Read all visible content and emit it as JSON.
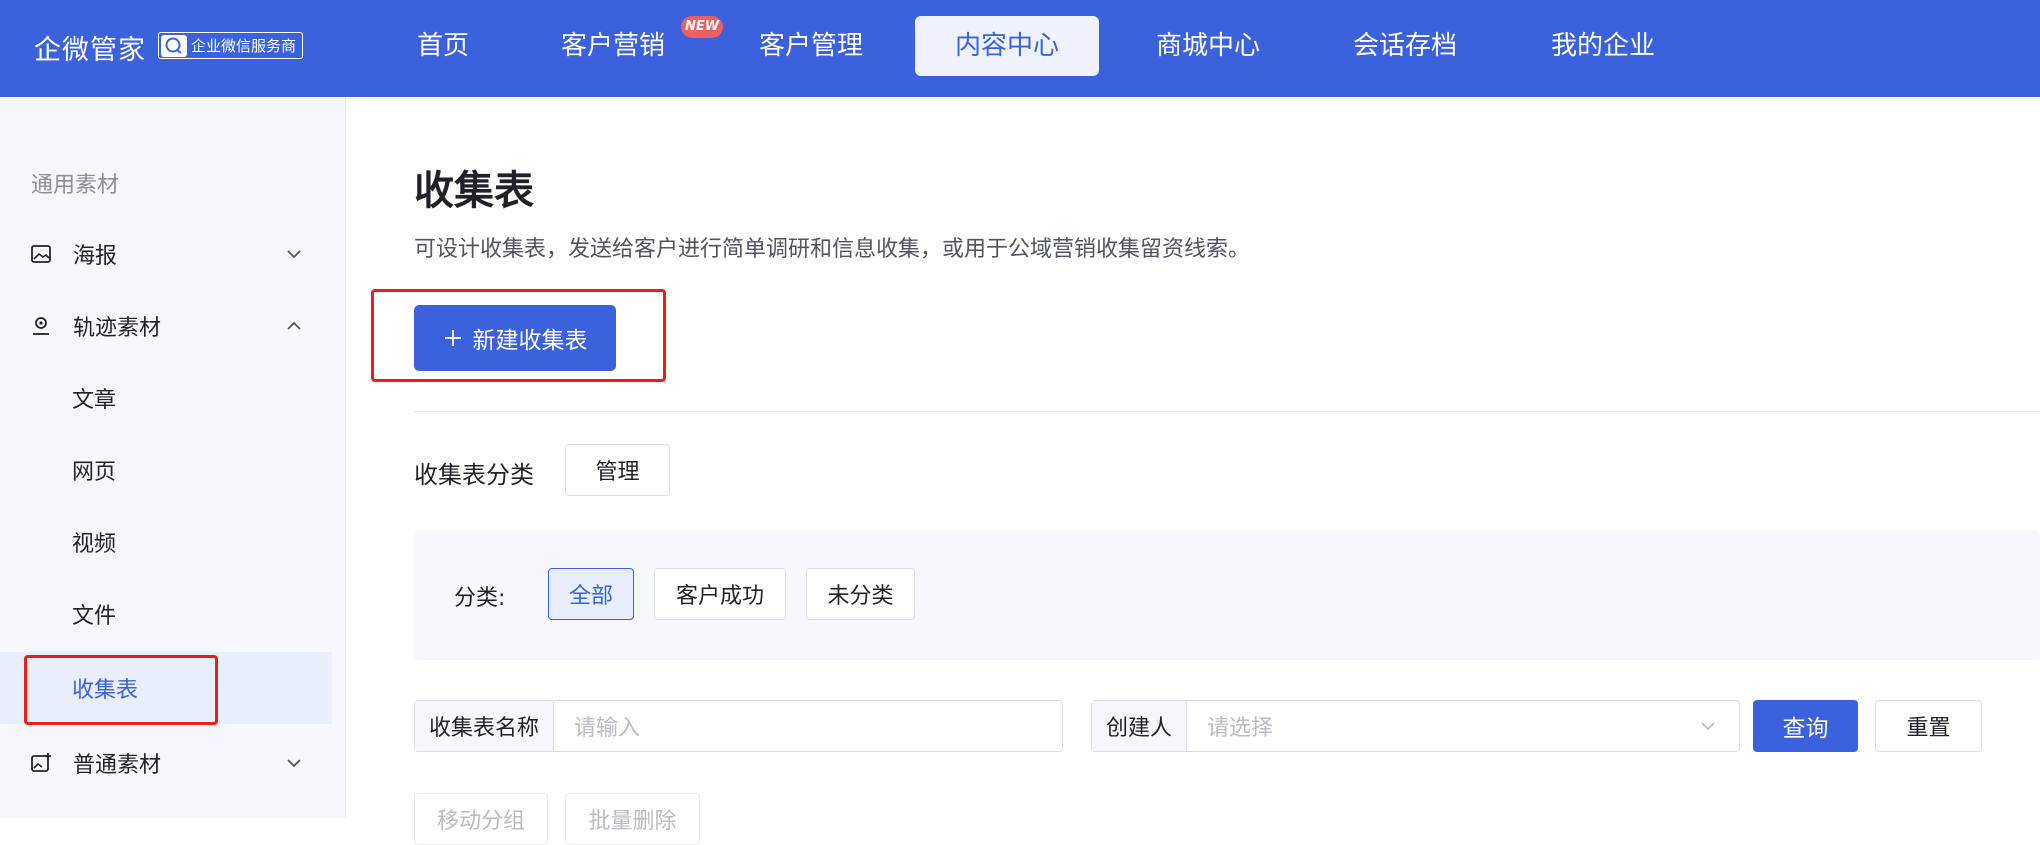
{
  "brand": {
    "name": "企微管家",
    "badge": "企业微信服务商"
  },
  "nav": {
    "items": [
      "首页",
      "客户营销",
      "客户管理",
      "内容中心",
      "商城中心",
      "会话存档",
      "我的企业"
    ],
    "new_tag": "NEW",
    "active": "内容中心"
  },
  "sidebar": {
    "group_title": "通用素材",
    "items": [
      {
        "label": "海报",
        "icon": "image-icon",
        "expanded": false
      },
      {
        "label": "轨迹素材",
        "icon": "location-pin-icon",
        "expanded": true
      },
      {
        "label": "普通素材",
        "icon": "image-plus-icon",
        "expanded": false
      }
    ],
    "sub_items": [
      "文章",
      "网页",
      "视频",
      "文件",
      "收集表"
    ],
    "active_sub": "收集表"
  },
  "main": {
    "title": "收集表",
    "description": "可设计收集表，发送给客户进行简单调研和信息收集，或用于公域营销收集留资线索。",
    "new_button": "新建收集表",
    "category_title": "收集表分类",
    "manage_button": "管理",
    "filter_label": "分类:",
    "filter_chips": [
      "全部",
      "客户成功",
      "未分类"
    ],
    "search": {
      "name_label": "收集表名称",
      "name_placeholder": "请输入",
      "creator_label": "创建人",
      "creator_placeholder": "请选择",
      "query_button": "查询",
      "reset_button": "重置"
    },
    "bulk_actions": [
      "移动分组",
      "批量删除"
    ]
  },
  "colors": {
    "primary": "#3b62dc",
    "highlight": "#ee1d1d",
    "new_tag": "#ee5f5f"
  }
}
